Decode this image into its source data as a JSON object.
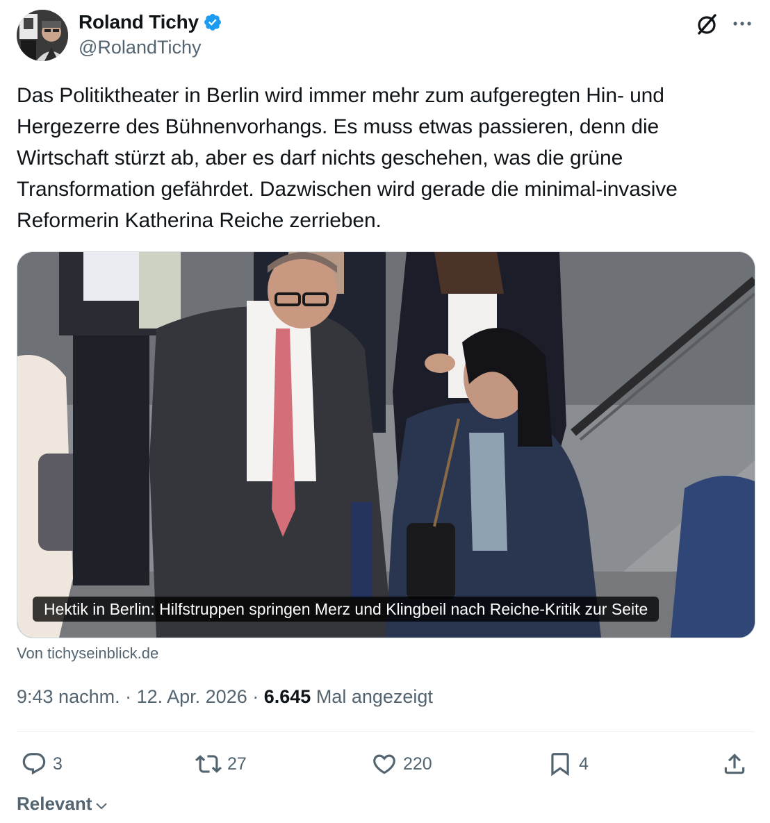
{
  "author": {
    "display_name": "Roland Tichy",
    "handle": "@RolandTichy",
    "verified_icon": "verified-badge-icon",
    "verified_color": "#1d9bf0"
  },
  "header_icons": [
    "grok-icon",
    "more-options-icon"
  ],
  "tweet": {
    "lines": [
      "Das Politiktheater in Berlin wird immer mehr zum aufgeregten Hin- und",
      "Hergezerre des Bühnenvorhangs. Es muss etwas passieren, denn die",
      "Wirtschaft stürzt ab, aber es darf nichts geschehen, was die grüne",
      "Transformation gefährdet. Dazwischen wird gerade die minimal-invasive",
      "Reformerin Katherina Reiche zerrieben."
    ]
  },
  "card": {
    "caption": "Hektik in Berlin: Hilfstruppen springen Merz und Klingbeil nach Reiche-Kritik zur Seite",
    "source": "Von tichyseinblick.de"
  },
  "meta": {
    "time": "9:43 nachm.",
    "separator": " · ",
    "date": "12. Apr. 2026",
    "views_count": "6.645",
    "views_label": " Mal angezeigt"
  },
  "actions": {
    "replies": "3",
    "reposts": "27",
    "likes": "220",
    "bookmarks": "4"
  },
  "action_icons": [
    "reply-icon",
    "repost-icon",
    "like-icon",
    "bookmark-icon",
    "share-icon"
  ],
  "sort": {
    "label": "Relevant",
    "icon": "chevron-down-icon"
  },
  "colors": {
    "text_primary": "#0f1419",
    "text_secondary": "#536471",
    "border": "#cfd9de",
    "divider": "#eff3f4"
  }
}
